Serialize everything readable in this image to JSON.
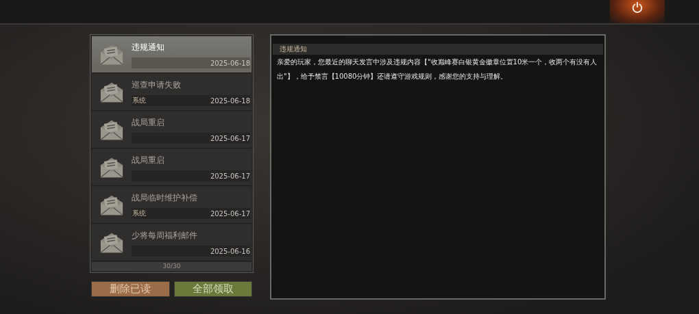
{
  "mails": [
    {
      "title": "违规通知",
      "date": "2025-06-18",
      "selected": true
    },
    {
      "title": "巡查申请失败",
      "sender": "系统",
      "date": "2025-06-18",
      "selected": false
    },
    {
      "title": "战局重启",
      "date": "2025-06-17",
      "selected": false
    },
    {
      "title": "战局重启",
      "date": "2025-06-17",
      "selected": false
    },
    {
      "title": "战局临时维护补偿",
      "sender": "系统",
      "date": "2025-06-17",
      "selected": false
    },
    {
      "title": "少将每周福利邮件",
      "date": "2025-06-16",
      "selected": false
    }
  ],
  "count": "30/30",
  "buttons": [
    {
      "label": "删除已读",
      "kind": "delete"
    },
    {
      "label": "全部领取",
      "kind": "claim"
    }
  ],
  "detail": {
    "title": "违规通知",
    "body": "亲爱的玩家，您最近的聊天发言中涉及违规内容【\"收巅峰赛白银黄金徽章位置10米一个，收两个有没有人出\"】，给予禁言【10080分钟】还请遵守游戏规则，感谢您的支持与理解。"
  }
}
